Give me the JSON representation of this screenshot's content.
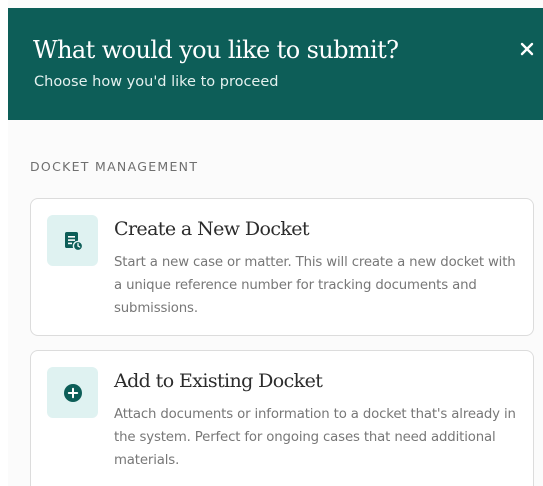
{
  "modal": {
    "title": "What would you like to submit?",
    "subtitle": "Choose how you'd like to proceed",
    "close_label": "×"
  },
  "section": {
    "label": "DOCKET MANAGEMENT"
  },
  "options": [
    {
      "title": "Create a New Docket",
      "description": "Start a new case or matter. This will create a new docket with a unique reference number for tracking documents and submissions.",
      "icon": "new-docket-icon"
    },
    {
      "title": "Add to Existing Docket",
      "description": "Attach documents or information to a docket that's already in the system. Perfect for ongoing cases that need additional materials.",
      "icon": "add-circle-icon"
    }
  ],
  "colors": {
    "header_bg": "#0d5e58",
    "icon_tile_bg": "#dff2f1",
    "icon_color": "#0d5e58"
  }
}
